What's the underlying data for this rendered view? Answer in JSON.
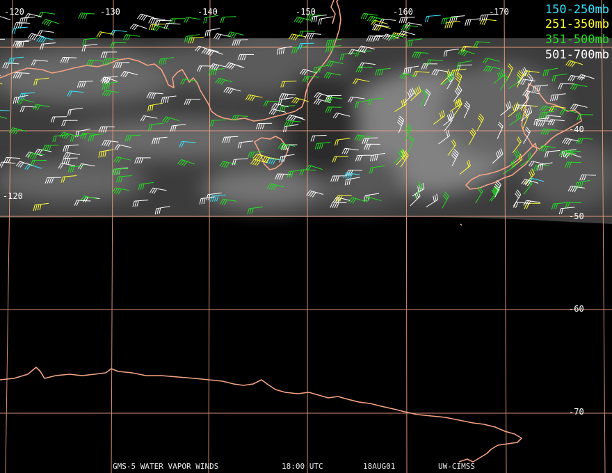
{
  "longitude_labels": [
    "-120",
    "-130",
    "-140",
    "-150",
    "-160",
    "-170"
  ],
  "latitude_labels": [
    "-40",
    "-50",
    "-60",
    "-70"
  ],
  "legend": [
    {
      "label": "150-250mb",
      "color": "#33e6ff"
    },
    {
      "label": "251-350mb",
      "color": "#ffff33"
    },
    {
      "label": "351-500mb",
      "color": "#22dd22"
    },
    {
      "label": "501-700mb",
      "color": "#ffffff"
    }
  ],
  "footer": {
    "product": "GMS-5 WATER VAPOR WINDS",
    "time": "18:00 UTC",
    "date": "18AUG01",
    "credit": "UW-CIMSS"
  },
  "colors": {
    "background": "#000000",
    "gridline": "#f0a080",
    "coastline": "#f4a384",
    "imagery": "#5a5a5a"
  }
}
